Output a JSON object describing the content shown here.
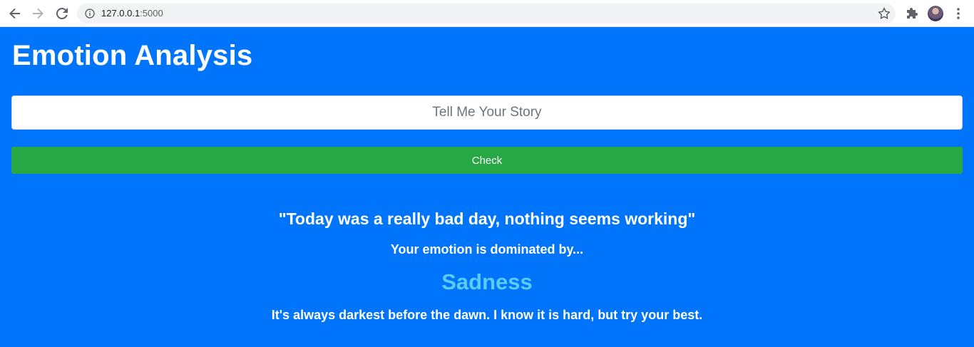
{
  "browser": {
    "url_host": "127.0.0.1",
    "url_port": ":5000"
  },
  "page": {
    "title": "Emotion Analysis",
    "story_placeholder": "Tell Me Your Story",
    "check_label": "Check",
    "quote": "\"Today was a really bad day, nothing seems working\"",
    "lead": "Your emotion is dominated by...",
    "emotion": "Sadness",
    "advice": "It's always darkest before the dawn. I know it is hard, but try your best."
  },
  "colors": {
    "page_bg": "#0074fb",
    "button_bg": "#28a745",
    "emotion_text": "#5bcbf8"
  },
  "icons": {
    "back": "arrow-left-icon",
    "forward": "arrow-right-icon",
    "reload": "reload-icon",
    "info": "info-icon",
    "bookmark": "star-icon",
    "extensions": "puzzle-icon",
    "menu": "kebab-menu-icon"
  }
}
